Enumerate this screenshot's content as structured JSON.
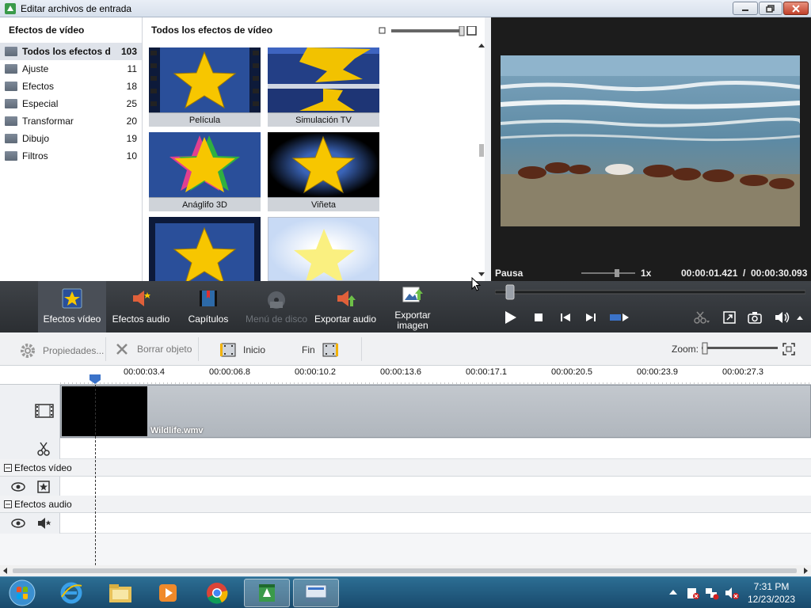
{
  "window": {
    "title": "Editar archivos de entrada"
  },
  "left_panel": {
    "header": "Efectos de vídeo",
    "categories": [
      {
        "label": "Todos los efectos d...",
        "count": "103"
      },
      {
        "label": "Ajuste",
        "count": "11"
      },
      {
        "label": "Efectos",
        "count": "18"
      },
      {
        "label": "Especial",
        "count": "25"
      },
      {
        "label": "Transformar",
        "count": "20"
      },
      {
        "label": "Dibujo",
        "count": "19"
      },
      {
        "label": "Filtros",
        "count": "10"
      }
    ]
  },
  "effects_panel": {
    "header": "Todos los efectos de vídeo",
    "effects": [
      "Película",
      "Simulación TV",
      "Anáglifo 3D",
      "Viñeta"
    ]
  },
  "preview": {
    "status": "Pausa",
    "speed": "1x",
    "current_time": "00:00:01.421",
    "separator": "/",
    "total_time": "00:00:30.093"
  },
  "toolbar": {
    "video_effects": "Efectos vídeo",
    "audio_effects": "Efectos audio",
    "chapters": "Capítulos",
    "disc_menu": "Menú de disco",
    "export_audio": "Exportar audio",
    "export_image_line1": "Exportar",
    "export_image_line2": "imagen"
  },
  "editbar": {
    "properties": "Propiedades...",
    "delete_object": "Borrar objeto",
    "start": "Inicio",
    "end": "Fin",
    "zoom": "Zoom:"
  },
  "timeline": {
    "ticks": [
      "00:00:03.4",
      "00:00:06.8",
      "00:00:10.2",
      "00:00:13.6",
      "00:00:17.1",
      "00:00:20.5",
      "00:00:23.9",
      "00:00:27.3"
    ],
    "clip_name": "Wildlife.wmv",
    "video_effects_section": "Efectos vídeo",
    "audio_effects_section": "Efectos audio"
  },
  "taskbar": {
    "time": "7:31 PM",
    "date": "12/23/2023"
  },
  "colors": {
    "toolbar_bg": "#2b2e32",
    "taskbar_bg": "#194a6c",
    "accent_blue": "#3b73c9"
  }
}
